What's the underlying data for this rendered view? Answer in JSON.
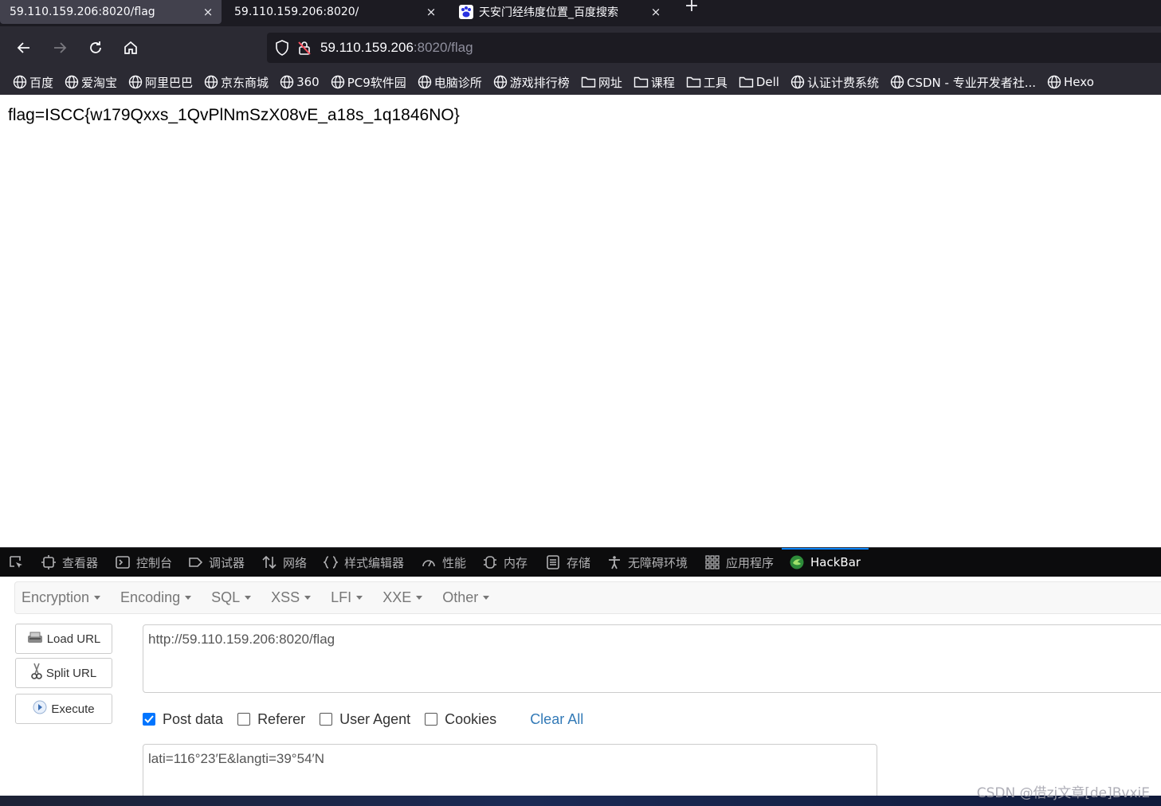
{
  "browser": {
    "tabs": [
      {
        "title": "59.110.159.206:8020/flag",
        "active": true
      },
      {
        "title": "59.110.159.206:8020/",
        "active": false
      },
      {
        "title": "天安门经纬度位置_百度搜索",
        "active": false
      }
    ],
    "tab_close_glyph": "×",
    "new_tab_glyph": "+",
    "url_host": "59.110.159.206",
    "url_rest": ":8020/flag",
    "bookmarks": [
      {
        "label": "百度",
        "icon": "globe-icon"
      },
      {
        "label": "爱淘宝",
        "icon": "globe-icon"
      },
      {
        "label": "阿里巴巴",
        "icon": "globe-icon"
      },
      {
        "label": "京东商城",
        "icon": "globe-icon"
      },
      {
        "label": "360",
        "icon": "globe-icon"
      },
      {
        "label": "PC9软件园",
        "icon": "globe-icon"
      },
      {
        "label": "电脑诊所",
        "icon": "globe-icon"
      },
      {
        "label": "游戏排行榜",
        "icon": "globe-icon"
      },
      {
        "label": "网址",
        "icon": "folder-icon"
      },
      {
        "label": "课程",
        "icon": "folder-icon"
      },
      {
        "label": "工具",
        "icon": "folder-icon"
      },
      {
        "label": "Dell",
        "icon": "folder-icon"
      },
      {
        "label": "认证计费系统",
        "icon": "globe-icon"
      },
      {
        "label": "CSDN - 专业开发者社...",
        "icon": "globe-icon"
      },
      {
        "label": "Hexo",
        "icon": "globe-icon"
      }
    ]
  },
  "page": {
    "text": "flag=ISCC{w179Qxxs_1QvPlNmSzX08vE_a18s_1q1846NO}"
  },
  "devtools": {
    "tabs": [
      {
        "label": "查看器",
        "icon": "inspector-icon"
      },
      {
        "label": "控制台",
        "icon": "console-icon"
      },
      {
        "label": "调试器",
        "icon": "debugger-icon"
      },
      {
        "label": "网络",
        "icon": "network-icon"
      },
      {
        "label": "样式编辑器",
        "icon": "style-editor-icon"
      },
      {
        "label": "性能",
        "icon": "performance-icon"
      },
      {
        "label": "内存",
        "icon": "memory-icon"
      },
      {
        "label": "存储",
        "icon": "storage-icon"
      },
      {
        "label": "无障碍环境",
        "icon": "accessibility-icon"
      },
      {
        "label": "应用程序",
        "icon": "application-icon"
      },
      {
        "label": "HackBar",
        "icon": "hackbar-icon",
        "selected": true
      }
    ],
    "accent_color": "#0a84ff"
  },
  "hackbar": {
    "menu": [
      "Encryption",
      "Encoding",
      "SQL",
      "XSS",
      "LFI",
      "XXE",
      "Other"
    ],
    "buttons": {
      "load": "Load URL",
      "split": "Split URL",
      "execute": "Execute"
    },
    "url_value": "http://59.110.159.206:8020/flag",
    "options": [
      {
        "label": "Post data",
        "checked": true
      },
      {
        "label": "Referer",
        "checked": false
      },
      {
        "label": "User Agent",
        "checked": false
      },
      {
        "label": "Cookies",
        "checked": false
      }
    ],
    "clear_all": "Clear All",
    "post_value": "lati=116°23′E&langti=39°54′N"
  },
  "watermark": "CSDN @借zj文章[de]BvxiE"
}
